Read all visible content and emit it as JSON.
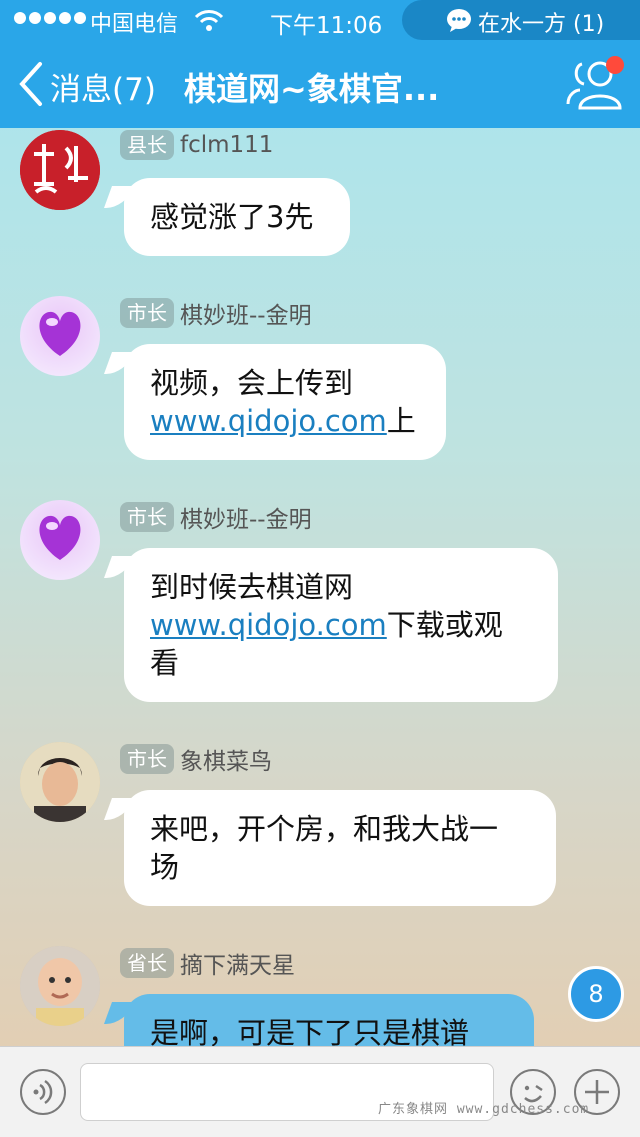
{
  "status_bar": {
    "carrier": "中国电信",
    "time": "下午11:06",
    "notification": "在水一方 (1)"
  },
  "nav": {
    "back_label": "消息(7)",
    "title": "棋道网~象棋官..."
  },
  "messages": [
    {
      "rank": "县长",
      "sender": "fclm111",
      "lines": [
        {
          "text": "感觉涨了3先"
        }
      ]
    },
    {
      "rank": "市长",
      "sender": "棋妙班--金明",
      "lines": [
        {
          "text": "视频，会上传到"
        },
        {
          "link": "www.qidojo.com",
          "text": "上"
        }
      ]
    },
    {
      "rank": "市长",
      "sender": "棋妙班--金明",
      "lines": [
        {
          "text": "到时候去棋道网"
        },
        {
          "link": "www.qidojo.com",
          "text": "下载或观"
        },
        {
          "text": "看"
        }
      ]
    },
    {
      "rank": "市长",
      "sender": "象棋菜鸟",
      "lines": [
        {
          "text": "来吧，开个房，和我大战一"
        },
        {
          "text": "场"
        }
      ]
    },
    {
      "rank": "省长",
      "sender": "摘下满天星",
      "lines": [
        {
          "text": "是啊，可是下了只是棋谱"
        }
      ]
    }
  ],
  "unread_count": "8",
  "watermark": "广东象棋网 www.gdchess.com",
  "colors": {
    "header": "#2aa6e8",
    "link": "#1a7fc0",
    "self_bubble": "#64bce8"
  }
}
